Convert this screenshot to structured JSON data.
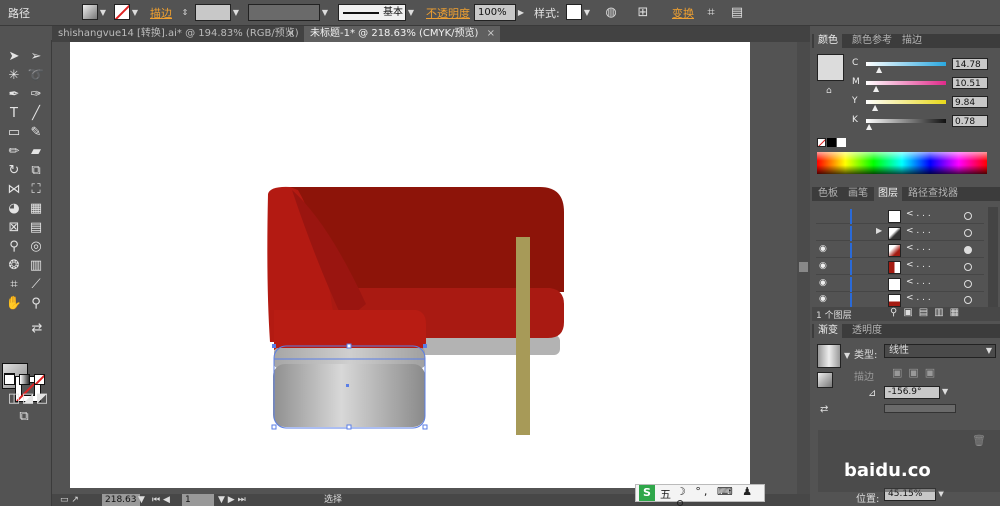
{
  "control_bar": {
    "selection_label": "路径",
    "stroke_label": "描边",
    "stroke_weight_value": "",
    "brush_label": "基本",
    "opacity_label": "不透明度",
    "opacity_value": "100%",
    "style_label": "样式",
    "transform_label": "变换"
  },
  "doc_tabs": [
    {
      "label": "shishangvue14 [转换].ai* @ 194.83% (RGB/预览)",
      "close": "×"
    },
    {
      "label": "未标题-1* @ 218.63% (CMYK/预览)",
      "close": "×"
    }
  ],
  "color_panel": {
    "tabs": [
      "颜色",
      "颜色参考",
      "描边"
    ],
    "sliders": [
      {
        "label": "C",
        "value": "14.78"
      },
      {
        "label": "M",
        "value": "10.51"
      },
      {
        "label": "Y",
        "value": "9.84"
      },
      {
        "label": "K",
        "value": "0.78"
      }
    ]
  },
  "layers_panel": {
    "tabs": [
      "色板",
      "画笔",
      "图层",
      "路径查找器"
    ],
    "row_label": "< . . .",
    "footer_label": "1 个图层"
  },
  "gradient_panel": {
    "tabs": [
      "渐变",
      "透明度"
    ],
    "type_label": "类型",
    "type_value": "线性",
    "stroke_label": "描边",
    "angle_value": "-156.9°",
    "position_label": "位置",
    "position_value": "45.15%"
  },
  "status_bar": {
    "zoom_value": "218.63",
    "page_value": "1",
    "mode_label": "选择"
  },
  "watermark": {
    "text": "baidu.co"
  },
  "ime": {
    "label": "五"
  },
  "colors": {
    "sofa_red": "#a41b12",
    "sofa_dark": "#8c1409",
    "seat_gray": "#b8b8b8",
    "leg_olive": "#a69958",
    "selection_blue": "#5a7ee6"
  }
}
